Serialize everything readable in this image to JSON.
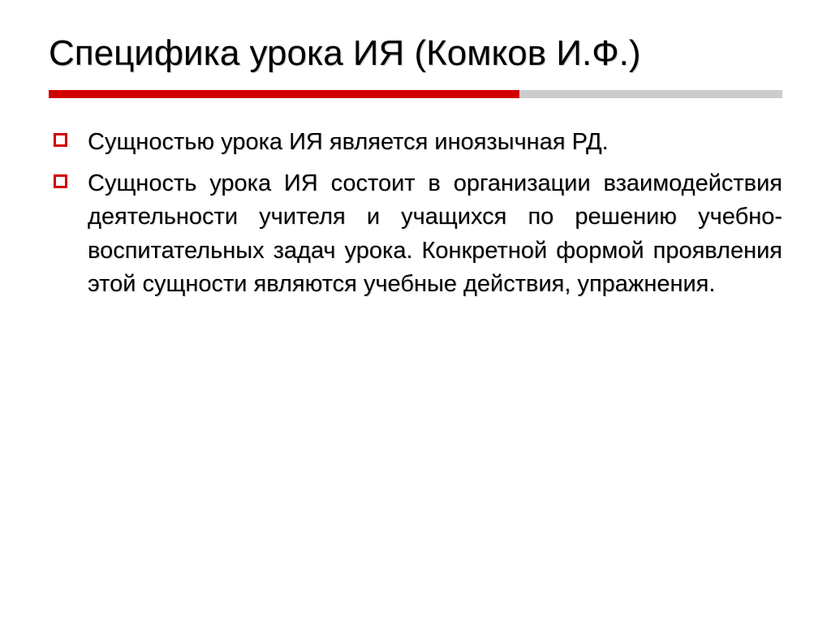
{
  "slide": {
    "title": "Специфика урока ИЯ (Комков И.Ф.)",
    "bullets": [
      "Сущностью урока ИЯ является иноязычная РД.",
      "Сущность урока ИЯ состоит в организации взаимодействия деятельности учителя и учащихся по решению учебно-воспитательных задач урока. Конкретной формой проявления этой сущности являются учебные действия, упражнения."
    ]
  }
}
